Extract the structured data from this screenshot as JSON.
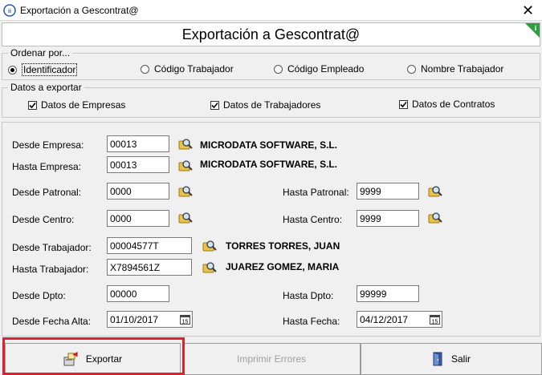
{
  "window": {
    "title": "Exportación a Gescontrat@",
    "close_symbol": "✕"
  },
  "header": {
    "title": "Exportación a Gescontrat@",
    "info_icon": "i"
  },
  "order_group": {
    "legend": "Ordenar por...",
    "options": [
      {
        "label": "Identificador",
        "checked": true
      },
      {
        "label": "Código Trabajador",
        "checked": false
      },
      {
        "label": "Código Empleado",
        "checked": false
      },
      {
        "label": "Nombre Trabajador",
        "checked": false
      }
    ]
  },
  "export_group": {
    "legend": "Datos a exportar",
    "checks": [
      {
        "label": "Datos de Empresas",
        "checked": true
      },
      {
        "label": "Datos de Trabajadores",
        "checked": true
      },
      {
        "label": "Datos de Contratos",
        "checked": true
      }
    ]
  },
  "form": {
    "desde_empresa": {
      "label": "Desde Empresa:",
      "value": "00013",
      "name": "MICRODATA SOFTWARE, S.L."
    },
    "hasta_empresa": {
      "label": "Hasta Empresa:",
      "value": "00013",
      "name": "MICRODATA SOFTWARE, S.L."
    },
    "desde_patronal": {
      "label": "Desde Patronal:",
      "value": "0000"
    },
    "hasta_patronal": {
      "label": "Hasta Patronal:",
      "value": "9999"
    },
    "desde_centro": {
      "label": "Desde Centro:",
      "value": "0000"
    },
    "hasta_centro": {
      "label": "Hasta Centro:",
      "value": "9999"
    },
    "desde_trabajador": {
      "label": "Desde Trabajador:",
      "value": "00004577T",
      "name": "TORRES TORRES, JUAN"
    },
    "hasta_trabajador": {
      "label": "Hasta Trabajador:",
      "value": "X7894561Z",
      "name": "JUAREZ GOMEZ, MARIA"
    },
    "desde_dpto": {
      "label": "Desde Dpto:",
      "value": "00000"
    },
    "hasta_dpto": {
      "label": "Hasta Dpto:",
      "value": "99999"
    },
    "desde_fecha_alta": {
      "label": "Desde Fecha Alta:",
      "value": "01/10/2017"
    },
    "hasta_fecha": {
      "label": "Hasta Fecha:",
      "value": "04/12/2017"
    },
    "calendar_text": "15"
  },
  "buttons": {
    "exportar": "Exportar",
    "imprimir_errores": "Imprimir Errores",
    "salir": "Salir"
  },
  "colors": {
    "highlight_frame": "#e0202a",
    "info_badge": "#2e9e3e"
  }
}
